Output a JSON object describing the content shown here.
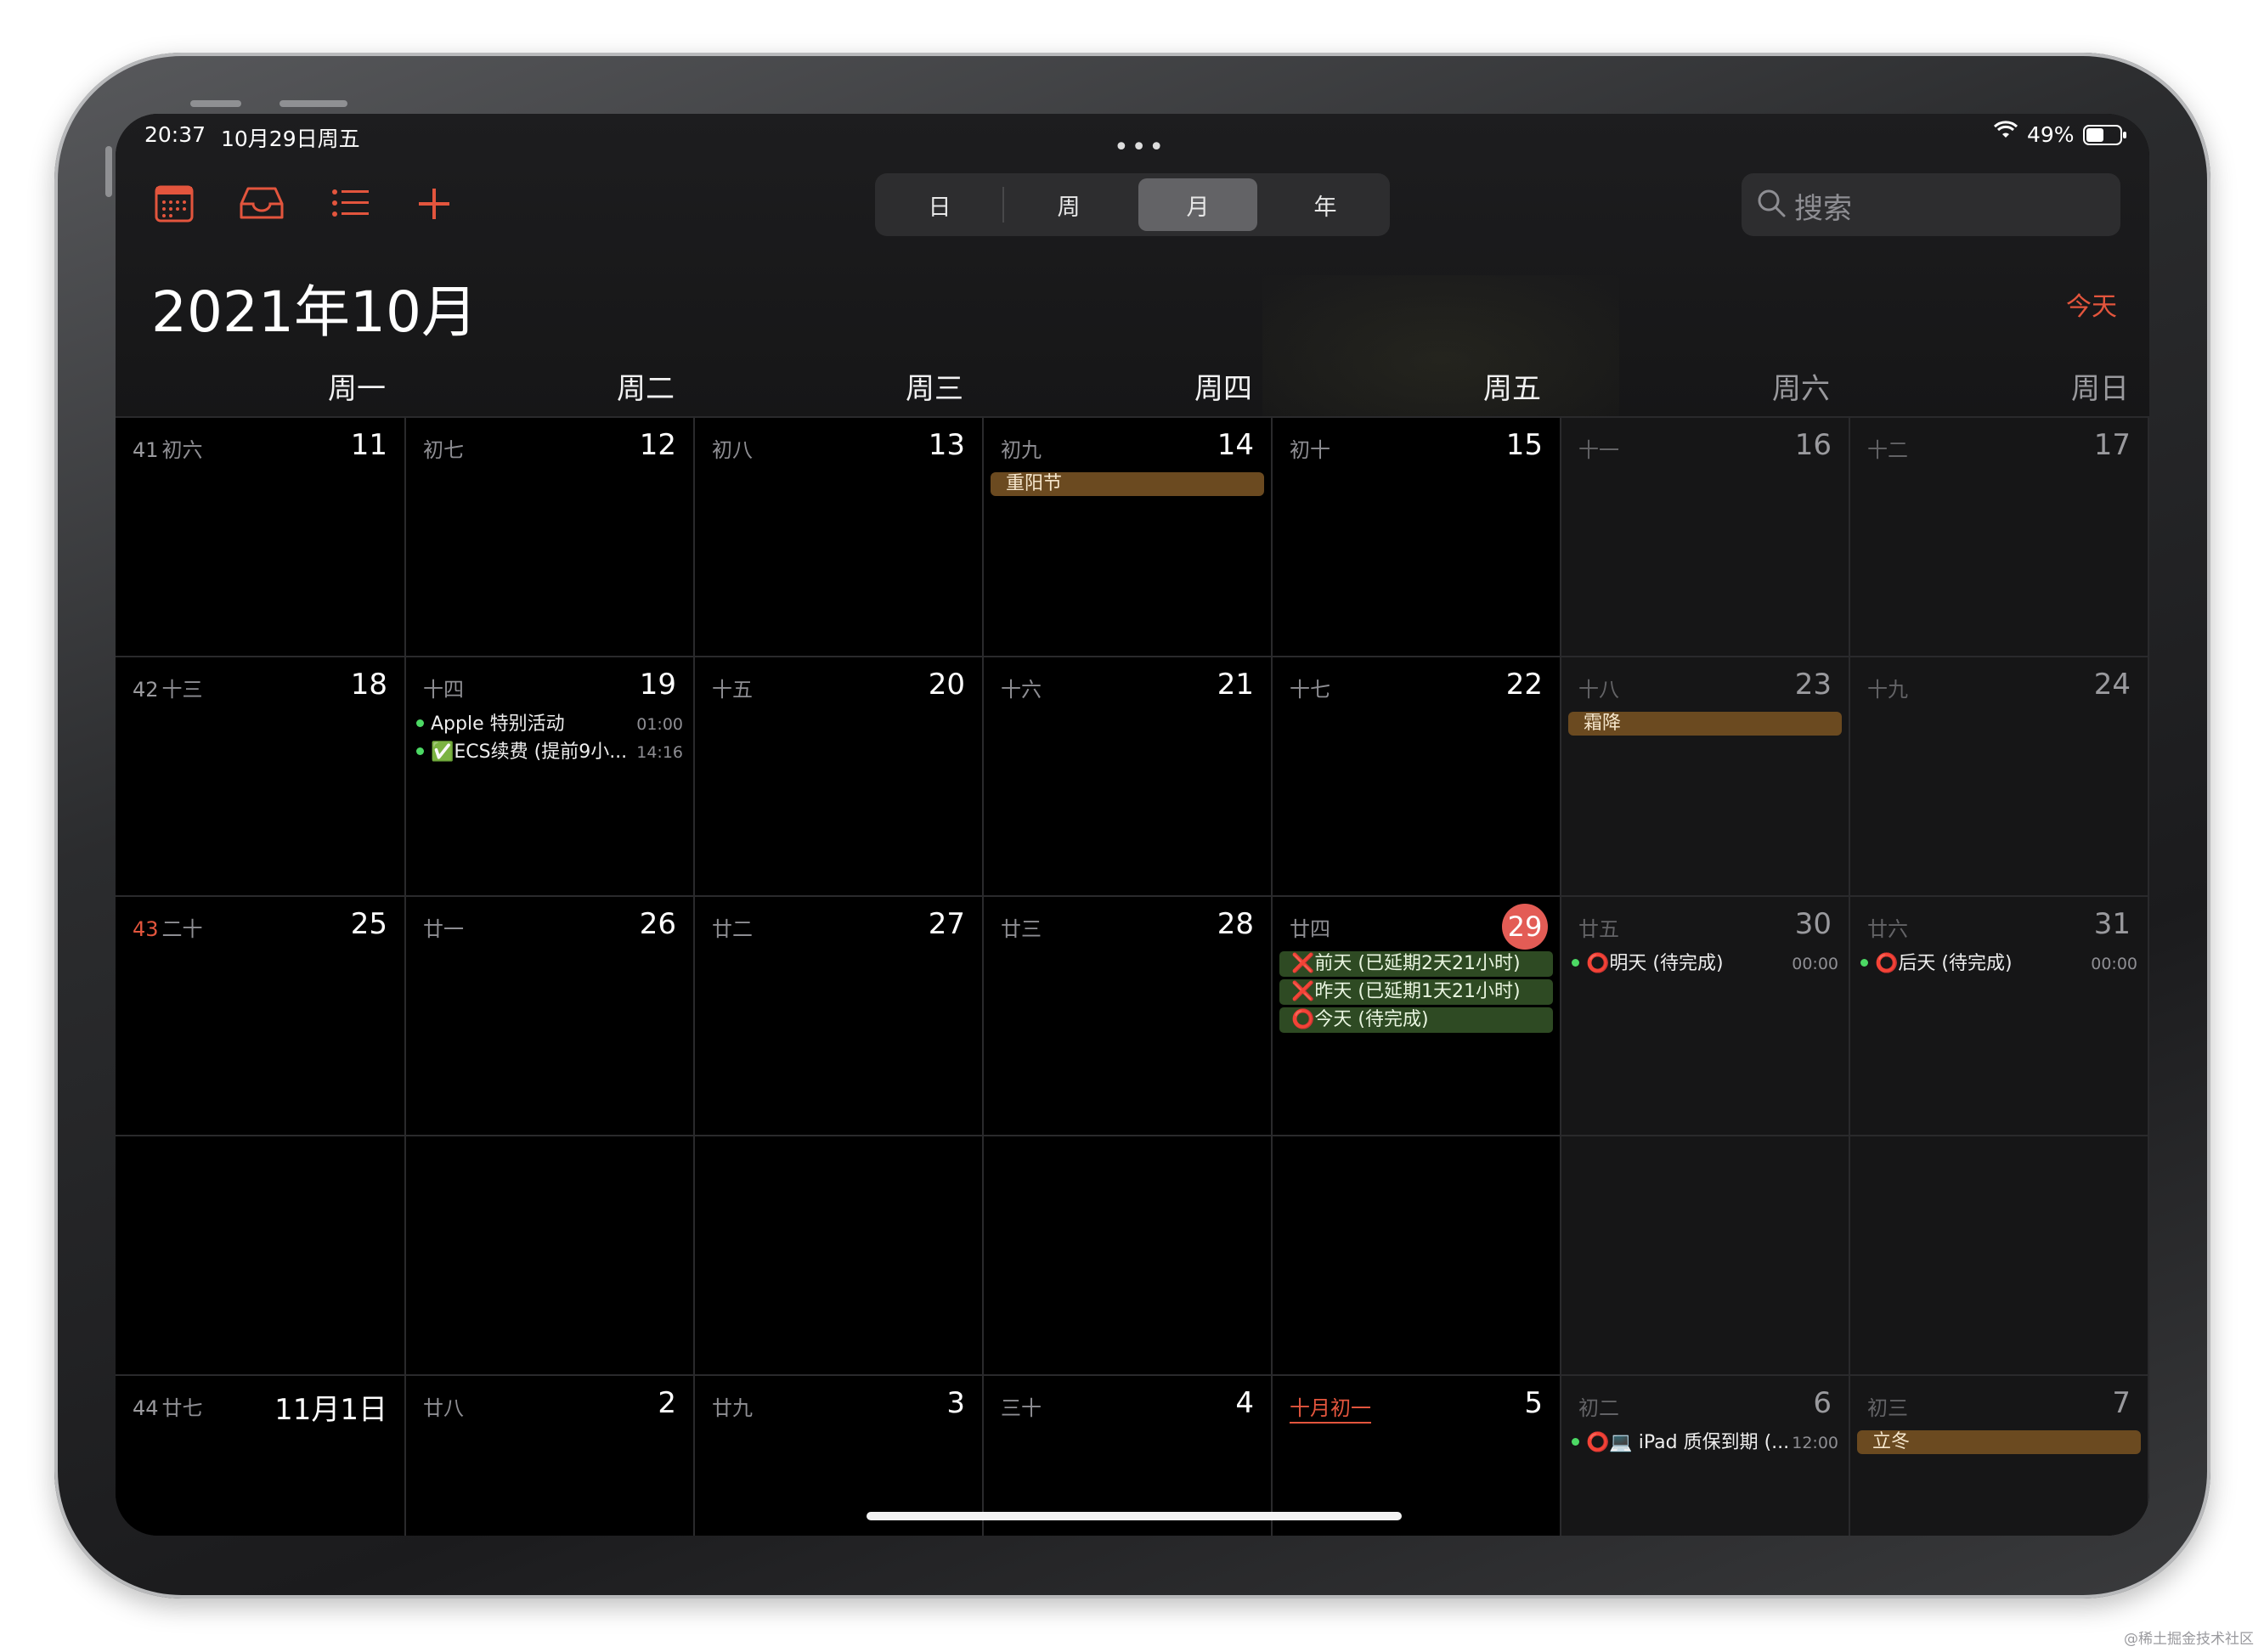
{
  "status": {
    "time": "20:37",
    "date": "10月29日周五",
    "battery": "49%"
  },
  "toolbar": {
    "views": [
      "日",
      "周",
      "月",
      "年"
    ],
    "active_view": "月",
    "search_placeholder": "搜索"
  },
  "title": "2021年10月",
  "today_label": "今天",
  "weekdays": [
    "周一",
    "周二",
    "周三",
    "周四",
    "周五",
    "周六",
    "周日"
  ],
  "weeks": [
    {
      "number": "41",
      "days": [
        {
          "day": "11",
          "lunar": "初六"
        },
        {
          "day": "12",
          "lunar": "初七"
        },
        {
          "day": "13",
          "lunar": "初八"
        },
        {
          "day": "14",
          "lunar": "初九",
          "allday": [
            "重阳节"
          ]
        },
        {
          "day": "15",
          "lunar": "初十"
        },
        {
          "day": "16",
          "lunar": "十一"
        },
        {
          "day": "17",
          "lunar": "十二"
        }
      ]
    },
    {
      "number": "42",
      "days": [
        {
          "day": "18",
          "lunar": "十三"
        },
        {
          "day": "19",
          "lunar": "十四",
          "timed": [
            {
              "title": "Apple 特别活动",
              "time": "01:00"
            },
            {
              "title": "✅ECS续费 (提前9小...",
              "time": "14:16"
            }
          ]
        },
        {
          "day": "20",
          "lunar": "十五"
        },
        {
          "day": "21",
          "lunar": "十六"
        },
        {
          "day": "22",
          "lunar": "十七"
        },
        {
          "day": "23",
          "lunar": "十八",
          "allday": [
            "霜降"
          ]
        },
        {
          "day": "24",
          "lunar": "十九"
        }
      ]
    },
    {
      "number": "43",
      "days": [
        {
          "day": "25",
          "lunar": "二十"
        },
        {
          "day": "26",
          "lunar": "廿一"
        },
        {
          "day": "27",
          "lunar": "廿二"
        },
        {
          "day": "28",
          "lunar": "廿三"
        },
        {
          "day": "29",
          "lunar": "廿四",
          "today": true,
          "reminders": [
            "❌前天 (已延期2天21小时)",
            "❌昨天 (已延期1天21小时)",
            "⭕今天 (待完成)"
          ]
        },
        {
          "day": "30",
          "lunar": "廿五",
          "timed": [
            {
              "title": "⭕明天 (待完成)",
              "time": "00:00"
            }
          ]
        },
        {
          "day": "31",
          "lunar": "廿六",
          "timed": [
            {
              "title": "⭕后天 (待完成)",
              "time": "00:00"
            }
          ]
        }
      ]
    },
    {
      "number": "",
      "days": [
        {
          "day": "",
          "lunar": ""
        },
        {
          "day": "",
          "lunar": ""
        },
        {
          "day": "",
          "lunar": ""
        },
        {
          "day": "",
          "lunar": ""
        },
        {
          "day": "",
          "lunar": ""
        },
        {
          "day": "",
          "lunar": ""
        },
        {
          "day": "",
          "lunar": ""
        }
      ]
    },
    {
      "number": "44",
      "days": [
        {
          "day": "11月1日",
          "lunar": "廿七"
        },
        {
          "day": "2",
          "lunar": "廿八"
        },
        {
          "day": "3",
          "lunar": "廿九"
        },
        {
          "day": "4",
          "lunar": "三十"
        },
        {
          "day": "5",
          "lunar": "十月初一",
          "month_start": true
        },
        {
          "day": "6",
          "lunar": "初二",
          "timed": [
            {
              "title": "⭕💻 iPad 质保到期 (...",
              "time": "12:00"
            }
          ]
        },
        {
          "day": "7",
          "lunar": "初三",
          "allday": [
            "立冬"
          ]
        }
      ]
    }
  ],
  "watermark": "@稀土掘金技术社区",
  "colors": {
    "accent": "#e3553d",
    "today": "#e35c55",
    "holiday": "#6b4a20",
    "reminder": "#2e4a23"
  }
}
